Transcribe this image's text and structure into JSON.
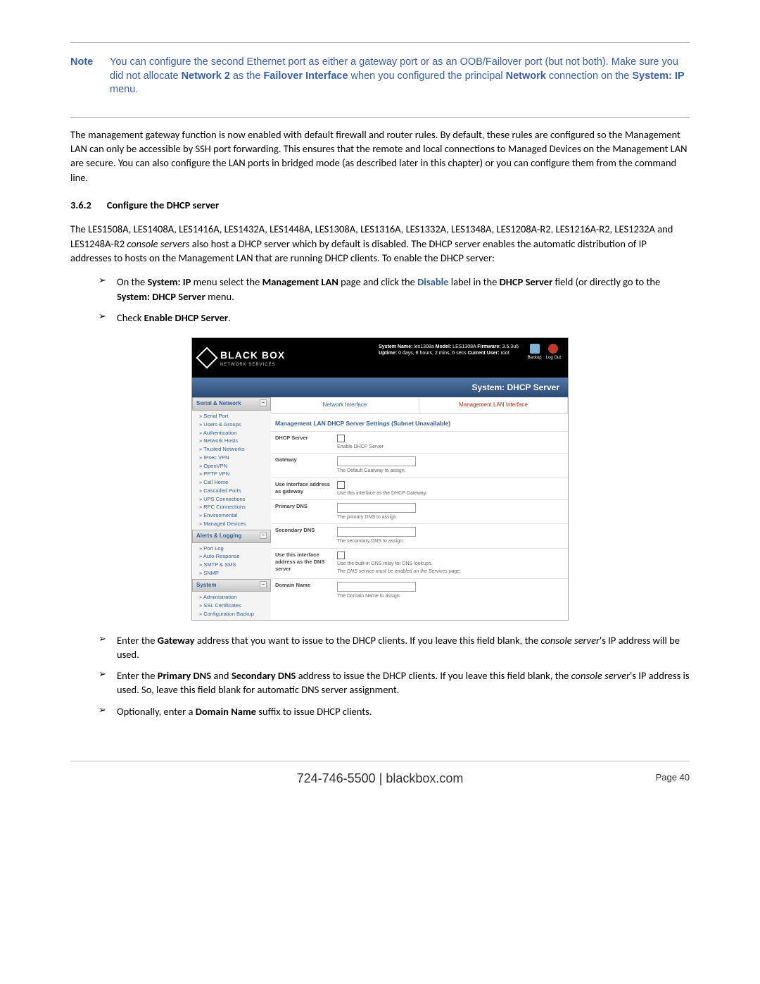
{
  "note": {
    "label": "Note",
    "text_1": "You can configure the second Ethernet port as either a gateway port or as an OOB/Failover port (but not both). Make sure you did not allocate ",
    "b1": "Network 2",
    "text_2": " as the ",
    "b2": "Failover Interface",
    "text_3": " when you configured the principal ",
    "b3": "Network",
    "text_4": " connection on the ",
    "b4": "System: IP",
    "text_5": " menu."
  },
  "para1": "The management gateway function is now enabled with default firewall and router rules. By default, these rules are configured so the Management LAN can only be accessible by SSH port forwarding. This ensures that the remote and local connections to Managed Devices on the Management LAN are secure. You can also configure the LAN ports in bridged mode (as described later in this chapter) or you can configure them from the command line.",
  "heading": {
    "num": "3.6.2",
    "text": "Configure the DHCP server"
  },
  "para2_a": "The LES1508A, LES1408A, LES1416A, LES1432A, LES1448A, LES1308A, LES1316A, LES1332A, LES1348A, LES1208A-R2, LES1216A-R2, LES1232A and LES1248A-R2 ",
  "para2_i": "console servers",
  "para2_b": " also host a DHCP server which by default is disabled. The DHCP server enables the automatic distribution of IP addresses to hosts on the Management LAN that are running DHCP clients. To enable the DHCP server:",
  "bullet1": {
    "t1": "On the ",
    "b1": "System: IP",
    "t2": " menu select the ",
    "b2": "Management LAN",
    "t3": " page and click the ",
    "blue": "Disable",
    "t4": " label in the ",
    "b3": "DHCP Server",
    "t5": " field (or directly go to the ",
    "b4": "System: DHCP Server",
    "t6": " menu."
  },
  "bullet2": {
    "t1": "Check ",
    "b1": "Enable DHCP Server",
    "t2": "."
  },
  "screenshot": {
    "logo": "BLACK BOX",
    "logo_sub": "NETWORK SERVICES",
    "sys_line1_a": "System Name:",
    "sys_line1_b": " les1308a  ",
    "sys_line1_c": "Model:",
    "sys_line1_d": " LES1308A  ",
    "sys_line1_e": "Firmware:",
    "sys_line1_f": " 3.5.3u5",
    "sys_line2_a": "Uptime:",
    "sys_line2_b": " 0 days, 8 hours, 2 mins, 6 secs  ",
    "sys_line2_c": "Current User:",
    "sys_line2_d": " root",
    "icon_backup": "Backup",
    "icon_logout": "Log Out",
    "titlebar": "System: DHCP Server",
    "sb1_header": "Serial & Network",
    "sb1_items": [
      "Serial Port",
      "Users & Groups",
      "Authentication",
      "Network Hosts",
      "Trusted Networks",
      "IPsec VPN",
      "OpenVPN",
      "PPTP VPN",
      "Call Home",
      "Cascaded Ports",
      "UPS Connections",
      "RPC Connections",
      "Environmental",
      "Managed Devices"
    ],
    "sb2_header": "Alerts & Logging",
    "sb2_items": [
      "Port Log",
      "Auto-Response",
      "SMTP & SMS",
      "SNMP"
    ],
    "sb3_header": "System",
    "sb3_items": [
      "Administration",
      "SSL Certificates",
      "Configuration Backup"
    ],
    "tab1": "Network Interface",
    "tab2": "Management LAN Interface",
    "section_title": "Management LAN DHCP Server Settings (Subnet Unavailable)",
    "rows": {
      "dhcp_label": "DHCP Server",
      "dhcp_hint": "Enable DHCP Server",
      "gw_label": "Gateway",
      "gw_hint": "The Default Gateway to assign.",
      "ui_gw_label": "Use interface address as gateway",
      "ui_gw_hint": "Use this interface as the DHCP Gateway.",
      "pdns_label": "Primary DNS",
      "pdns_hint": "The primary DNS to assign.",
      "sdns_label": "Secondary DNS",
      "sdns_hint": "The secondary DNS to assign.",
      "udns_label": "Use this interface address as the DNS server",
      "udns_hint1": "Use the built-in DNS relay for DNS lookups.",
      "udns_hint2": "The DNS service must be enabled on the Services page.",
      "dn_label": "Domain Name",
      "dn_hint": "The Domain Name to assign."
    }
  },
  "bullet3": {
    "t1": "Enter the ",
    "b1": "Gateway",
    "t2": " address that you want to issue to the DHCP clients. If you leave this field blank, the ",
    "i1": "console server",
    "t3": "'s IP address will be used."
  },
  "bullet4": {
    "t1": "Enter the ",
    "b1": "Primary DNS",
    "t2": " and ",
    "b2": "Secondary DNS",
    "t3": " address to issue the DHCP clients. If you leave this field blank, the ",
    "i1": "console server",
    "t4": "'s IP address is used. So, leave this field blank for automatic DNS server assignment."
  },
  "bullet5": {
    "t1": "Optionally, enter a ",
    "b1": "Domain Name",
    "t2": " suffix to issue DHCP clients."
  },
  "footer": {
    "center": "724-746-5500 | blackbox.com",
    "right": "Page 40"
  }
}
